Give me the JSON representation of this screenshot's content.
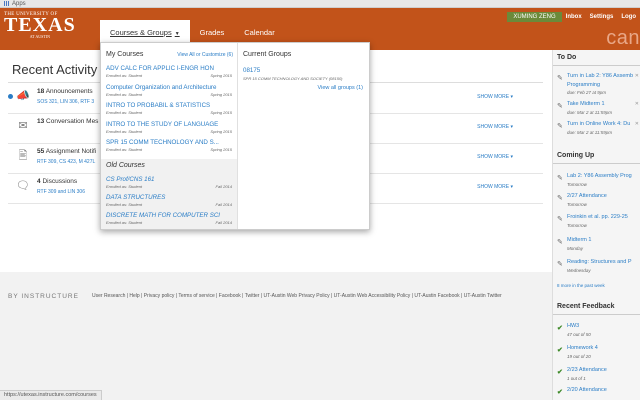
{
  "browser": {
    "apps_label": "Apps"
  },
  "header": {
    "logo_small": "THE UNIVERSITY OF",
    "logo_big": "TEXAS",
    "logo_sub": "AT AUSTIN",
    "nav": [
      "Courses & Groups",
      "Grades",
      "Calendar"
    ],
    "user_name": "XUMING ZENG",
    "user_links": [
      "Inbox",
      "Settings",
      "Logo"
    ],
    "cam_text": "can"
  },
  "main": {
    "title": "Recent Activity",
    "activities": [
      {
        "count": "18",
        "label": "Announcements",
        "sub": "SOS 321, LIN 306, RTF 3",
        "more": "SHOW MORE",
        "icon": "megaphone-icon"
      },
      {
        "count": "13",
        "label": "Conversation Mes",
        "sub": "",
        "more": "SHOW MORE",
        "icon": "envelope-icon"
      },
      {
        "count": "55",
        "label": "Assignment Notifi",
        "sub": "RTF 309, CS 423, M 427L",
        "more": "SHOW MORE",
        "icon": "assignment-icon"
      },
      {
        "count": "4",
        "label": "Discussions",
        "sub": "RTF 309 and LIN 306",
        "more": "SHOW MORE",
        "icon": "discussion-icon"
      }
    ]
  },
  "dropdown": {
    "my_courses_title": "My Courses",
    "view_all": "View All or Customize (6)",
    "courses": [
      {
        "name": "ADV CALC FOR APPLIC I-ENGR HON",
        "enrolled": "Enrolled as: Student",
        "term": "Spring 2015"
      },
      {
        "name": "Computer Organization and Architecture",
        "enrolled": "Enrolled as: Student",
        "term": "Spring 2015"
      },
      {
        "name": "INTRO TO PROBABIL & STATISTICS",
        "enrolled": "Enrolled as: Student",
        "term": "Spring 2015"
      },
      {
        "name": "INTRO TO THE STUDY OF LANGUAGE",
        "enrolled": "Enrolled as: Student",
        "term": "Spring 2015"
      },
      {
        "name": "SPR 15 COMM TECHNOLOGY AND S...",
        "enrolled": "Enrolled as: Student",
        "term": "Spring 2015"
      }
    ],
    "old_courses_title": "Old Courses",
    "old_courses": [
      {
        "name": "CS Prof/CNS 161",
        "enrolled": "Enrolled as: Student",
        "term": "Fall 2014"
      },
      {
        "name": "DATA STRUCTURES",
        "enrolled": "Enrolled as: Student",
        "term": "Fall 2014"
      },
      {
        "name": "DISCRETE MATH FOR COMPUTER SCI",
        "enrolled": "Enrolled as: Student",
        "term": "Fall 2014"
      }
    ],
    "groups_title": "Current Groups",
    "group_name": "08175",
    "group_sub": "SPR 15 COMM TECHNOLOGY AND SOCIETY (08150)",
    "all_groups": "View all groups (1)"
  },
  "sidebar": {
    "todo_title": "To Do",
    "todo": [
      {
        "title": "Turn in Lab 2: Y86 Assemb",
        "title2": "Programming",
        "date": "due: Feb 27 at 9pm"
      },
      {
        "title": "Take Midterm 1",
        "title2": "",
        "date": "due: Mar 2 at 11:59pm"
      },
      {
        "title": "Turn in Online Work 4: Du",
        "title2": "",
        "date": "due: Mar 2 at 11:59pm"
      }
    ],
    "coming_title": "Coming Up",
    "coming": [
      {
        "title": "Lab 2: Y86 Assembly Prog",
        "date": "Tomorrow"
      },
      {
        "title": "2/27 Attendance",
        "date": "Tomorrow"
      },
      {
        "title": "Froinkin et al. pp. 229-25",
        "date": "Tomorrow"
      },
      {
        "title": "Midterm 1",
        "date": "Monday"
      },
      {
        "title": "Reading: Structures and P",
        "date": "Wednesday"
      }
    ],
    "more_link": "8 more in the past week",
    "feedback_title": "Recent Feedback",
    "feedback": [
      {
        "title": "HW3",
        "score": "47 out of 50"
      },
      {
        "title": "Homework 4",
        "score": "19 out of 20"
      },
      {
        "title": "2/23 Attendance",
        "score": "1 out of 1"
      },
      {
        "title": "2/20 Attendance",
        "score": ""
      }
    ]
  },
  "footer": {
    "by": "BY INSTRUCTURE",
    "links": "User Research | Help | Privacy policy | Terms of service | Facebook | Twitter | UT-Austin Web Privacy Policy | UT-Austin Web Accessibility Policy | UT-Austin Facebook | UT-Austin Twitter"
  },
  "status_url": "https://utexas.instructure.com/courses"
}
